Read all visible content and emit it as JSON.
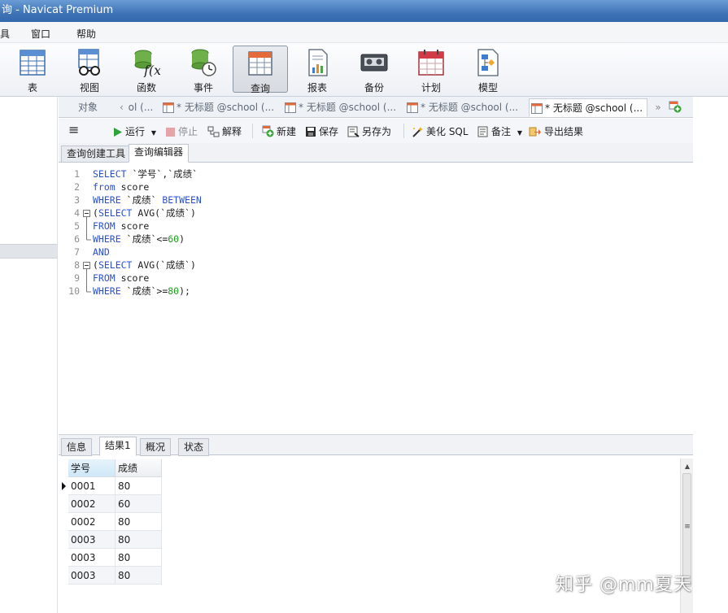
{
  "window": {
    "title": "询 - Navicat Premium"
  },
  "menu": {
    "items": [
      "具",
      "窗口",
      "帮助"
    ]
  },
  "ribbon": {
    "items": [
      {
        "label": "表",
        "icon": "table-icon"
      },
      {
        "label": "视图",
        "icon": "view-glasses-icon"
      },
      {
        "label": "函数",
        "icon": "function-icon"
      },
      {
        "label": "事件",
        "icon": "event-clock-icon"
      },
      {
        "label": "查询",
        "icon": "query-icon",
        "active": true
      },
      {
        "label": "报表",
        "icon": "report-icon"
      },
      {
        "label": "备份",
        "icon": "backup-icon"
      },
      {
        "label": "计划",
        "icon": "schedule-calendar-icon"
      },
      {
        "label": "模型",
        "icon": "model-icon"
      }
    ]
  },
  "doc_tabs": {
    "objects_label": "对象",
    "partial_tab": "ol (...",
    "tabs": [
      {
        "label": "* 无标题 @school (...",
        "active": false
      },
      {
        "label": "* 无标题 @school (...",
        "active": false
      },
      {
        "label": "* 无标题 @school (...",
        "active": false
      },
      {
        "label": "* 无标题 @school (...",
        "active": true
      }
    ]
  },
  "query_toolbar": {
    "run": "运行",
    "stop": "停止",
    "explain": "解释",
    "new": "新建",
    "save": "保存",
    "save_as": "另存为",
    "beautify": "美化 SQL",
    "comment": "备注",
    "export": "导出结果"
  },
  "editor_tabs": {
    "builder": "查询创建工具",
    "editor": "查询编辑器"
  },
  "sql_lines": [
    {
      "n": "1",
      "parts": [
        {
          "t": "SELECT",
          "c": "kw"
        },
        {
          "t": " `学号`,`成绩`",
          "c": "txt"
        }
      ]
    },
    {
      "n": "2",
      "parts": [
        {
          "t": "from",
          "c": "kw"
        },
        {
          "t": " score",
          "c": "txt"
        }
      ]
    },
    {
      "n": "3",
      "parts": [
        {
          "t": "WHERE",
          "c": "kw"
        },
        {
          "t": " `成绩` ",
          "c": "txt"
        },
        {
          "t": "BETWEEN",
          "c": "kw"
        }
      ]
    },
    {
      "n": "4",
      "parts": [
        {
          "t": "(",
          "c": "txt"
        },
        {
          "t": "SELECT",
          "c": "kw"
        },
        {
          "t": " AVG(`成绩`)",
          "c": "txt"
        }
      ]
    },
    {
      "n": "5",
      "parts": [
        {
          "t": "FROM",
          "c": "kw"
        },
        {
          "t": " score",
          "c": "txt"
        }
      ]
    },
    {
      "n": "6",
      "parts": [
        {
          "t": "WHERE",
          "c": "kw"
        },
        {
          "t": " `成绩`<=",
          "c": "txt"
        },
        {
          "t": "60",
          "c": "num"
        },
        {
          "t": ")",
          "c": "txt"
        }
      ]
    },
    {
      "n": "7",
      "parts": [
        {
          "t": "AND",
          "c": "kw"
        }
      ]
    },
    {
      "n": "8",
      "parts": [
        {
          "t": "(",
          "c": "txt"
        },
        {
          "t": "SELECT",
          "c": "kw"
        },
        {
          "t": " AVG(`成绩`)",
          "c": "txt"
        }
      ]
    },
    {
      "n": "9",
      "parts": [
        {
          "t": "FROM",
          "c": "kw"
        },
        {
          "t": " score",
          "c": "txt"
        }
      ]
    },
    {
      "n": "10",
      "parts": [
        {
          "t": "WHERE",
          "c": "kw"
        },
        {
          "t": " `成绩`>=",
          "c": "txt"
        },
        {
          "t": "80",
          "c": "num"
        },
        {
          "t": ");",
          "c": "txt"
        }
      ]
    }
  ],
  "result_tabs": [
    "信息",
    "结果1",
    "概况",
    "状态"
  ],
  "result_grid": {
    "columns": [
      "学号",
      "成绩"
    ],
    "rows": [
      [
        "0001",
        "80"
      ],
      [
        "0002",
        "60"
      ],
      [
        "0002",
        "80"
      ],
      [
        "0003",
        "80"
      ],
      [
        "0003",
        "80"
      ],
      [
        "0003",
        "80"
      ]
    ]
  },
  "watermark": "知乎 @mm夏天",
  "colors": {
    "keyword": "#2b4fd1",
    "number": "#1ca11c",
    "titlebar": "#3f74b8"
  }
}
